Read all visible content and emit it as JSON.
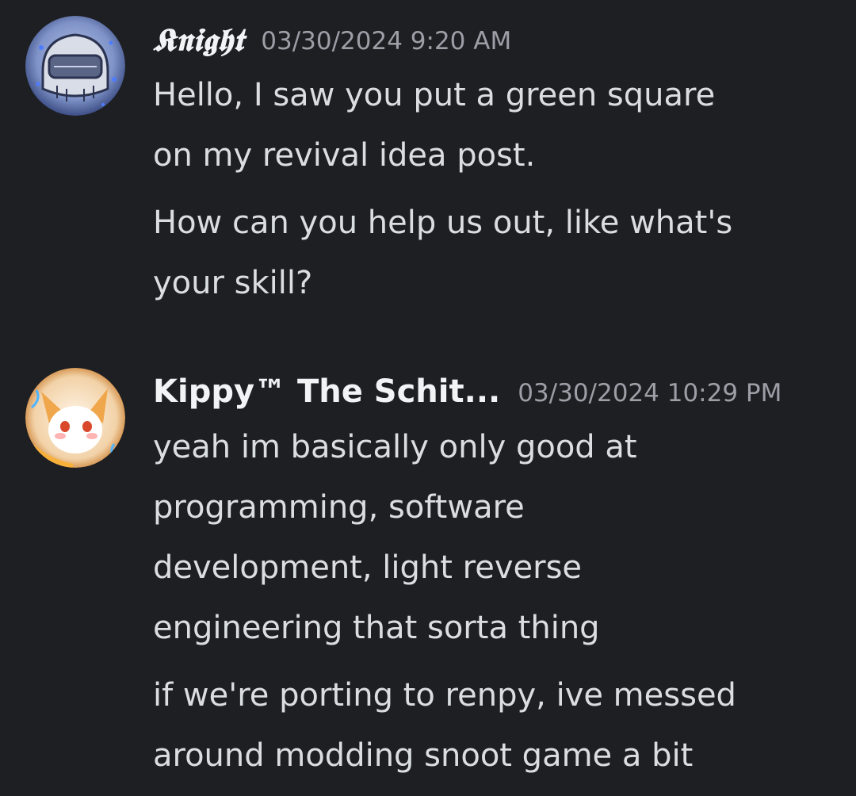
{
  "messages": [
    {
      "author": "𝕶𝖓𝖎𝖌𝖍𝖙",
      "timestamp": "03/30/2024 9:20 AM",
      "paragraphs": [
        [
          "Hello, I saw you put a green square",
          "on my revival idea post."
        ],
        [
          "How can you help us out, like what's",
          "your skill?"
        ]
      ]
    },
    {
      "author": "Kippy™ The Schit...",
      "timestamp": "03/30/2024 10:29 PM",
      "paragraphs": [
        [
          "yeah im basically only good at",
          "programming, software",
          "development, light reverse",
          "engineering that sorta thing"
        ],
        [
          "if we're porting to renpy, ive messed",
          "around modding snoot game a bit"
        ]
      ]
    }
  ]
}
